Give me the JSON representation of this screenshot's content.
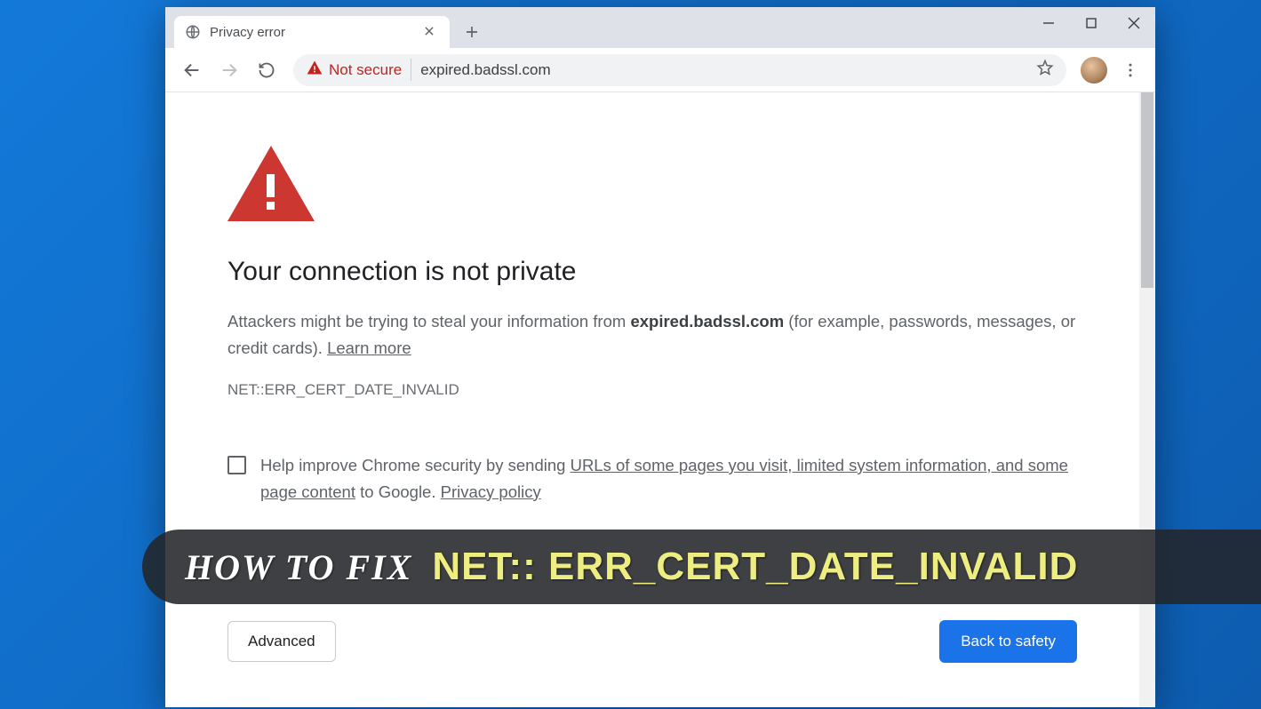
{
  "tab": {
    "title": "Privacy error"
  },
  "omnibox": {
    "security_label": "Not secure",
    "url": "expired.badssl.com"
  },
  "page": {
    "headline": "Your connection is not private",
    "p1_before": "Attackers might be trying to steal your information from ",
    "p1_bold": "expired.badssl.com",
    "p1_after": " (for example, passwords, messages, or credit cards). ",
    "learn_more": "Learn more",
    "error_code": "NET::ERR_CERT_DATE_INVALID",
    "consent_before": "Help improve Chrome security by sending ",
    "consent_link1": "URLs of some pages you visit, limited system information, and some page content",
    "consent_mid": " to Google. ",
    "consent_link2": "Privacy policy",
    "advanced": "Advanced",
    "back_to_safety": "Back to safety"
  },
  "banner": {
    "left": "HOW TO FIX",
    "right": "NET:: ERR_CERT_DATE_INVALID"
  }
}
